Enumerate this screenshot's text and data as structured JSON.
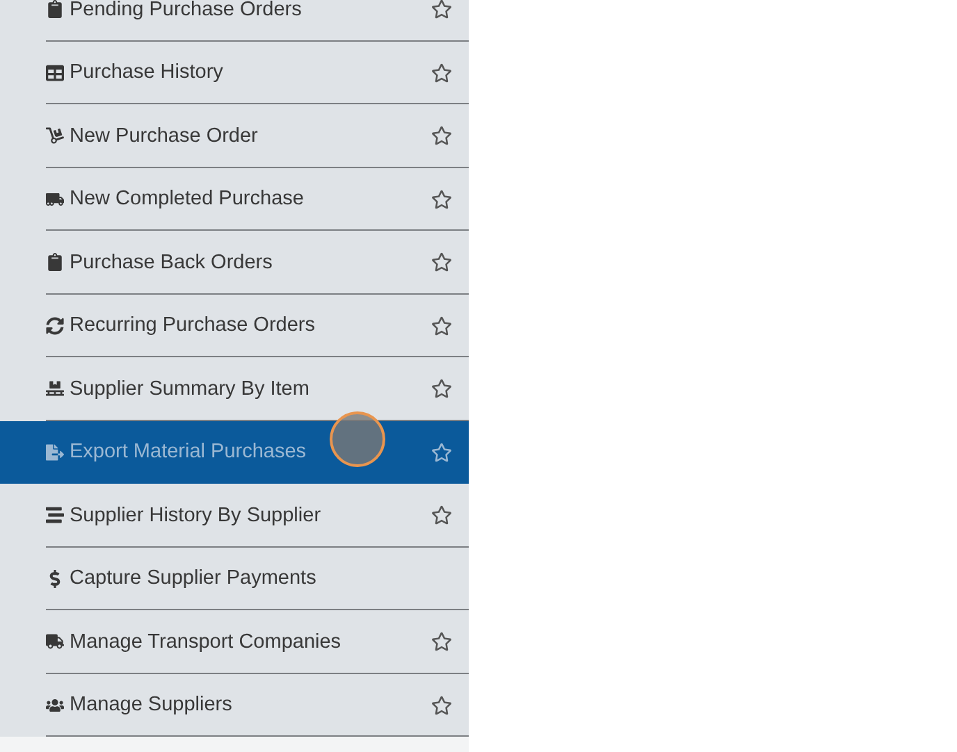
{
  "menu": {
    "items": [
      {
        "label": "Pending Purchase Orders",
        "selected": false,
        "star": true
      },
      {
        "label": "Purchase History",
        "selected": false,
        "star": true
      },
      {
        "label": "New Purchase Order",
        "selected": false,
        "star": true
      },
      {
        "label": "New Completed Purchase",
        "selected": false,
        "star": true
      },
      {
        "label": "Purchase Back Orders",
        "selected": false,
        "star": true
      },
      {
        "label": "Recurring Purchase Orders",
        "selected": false,
        "star": true
      },
      {
        "label": "Supplier Summary By Item",
        "selected": false,
        "star": true
      },
      {
        "label": "Export Material Purchases",
        "selected": true,
        "star": true
      },
      {
        "label": "Supplier History By Supplier",
        "selected": false,
        "star": true
      },
      {
        "label": "Capture Supplier Payments",
        "selected": false,
        "star": false
      },
      {
        "label": "Manage Transport Companies",
        "selected": false,
        "star": true
      },
      {
        "label": "Manage Suppliers",
        "selected": false,
        "star": true
      }
    ]
  }
}
